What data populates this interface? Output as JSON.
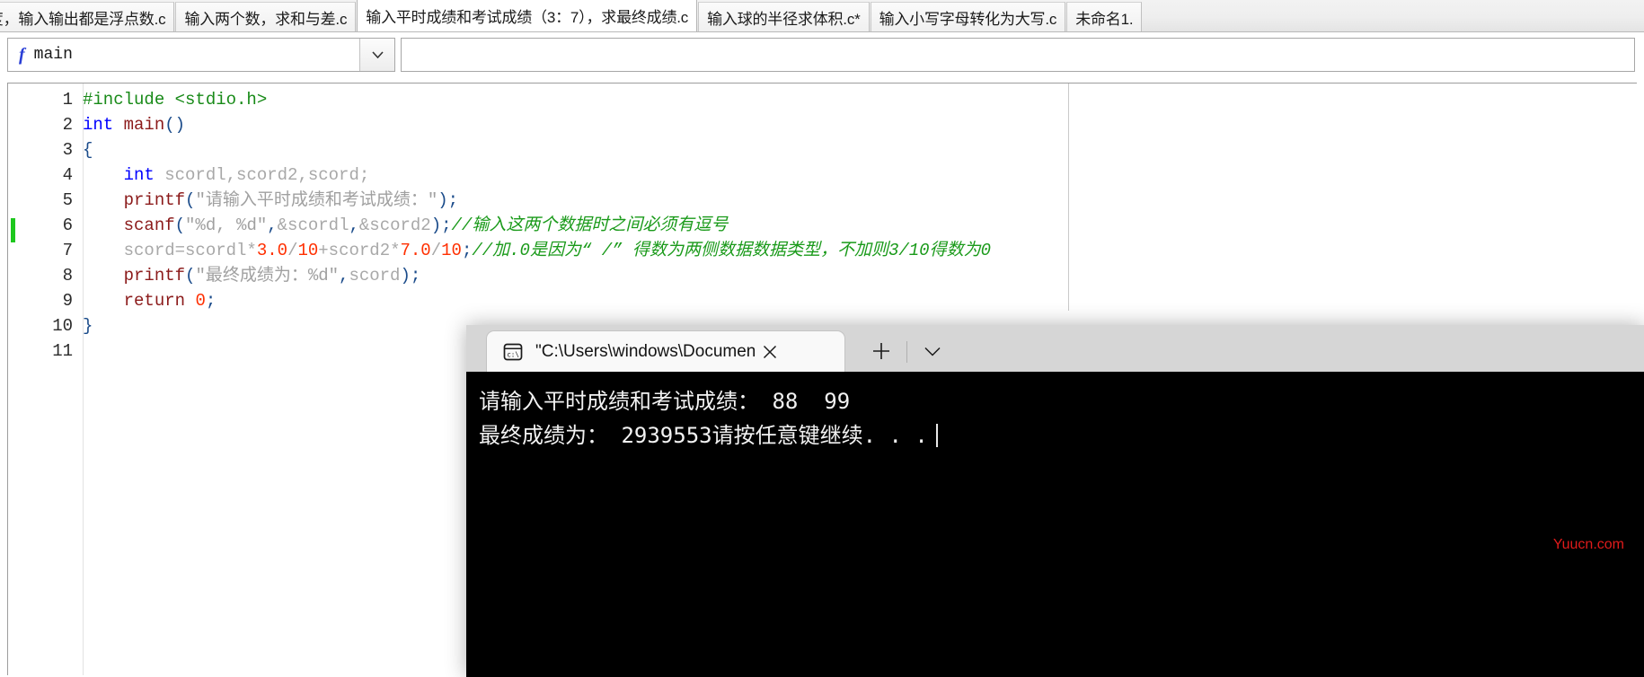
{
  "tabs": [
    {
      "label": "温度，输入输出都是浮点数.c",
      "active": false,
      "partial": true
    },
    {
      "label": "输入两个数，求和与差.c",
      "active": false
    },
    {
      "label": "输入平时成绩和考试成绩（3：7），求最终成绩.c",
      "active": true
    },
    {
      "label": "输入球的半径求体积.c*",
      "active": false
    },
    {
      "label": "输入小写字母转化为大写.c",
      "active": false
    },
    {
      "label": "未命名1.",
      "active": false,
      "partial": true
    }
  ],
  "func_selector": {
    "icon": "function-f-icon",
    "value": "main",
    "dropdown_icon": "chevron-down-icon"
  },
  "editor": {
    "change_marker_color": "#1ec81e",
    "lines": [
      {
        "num": "1",
        "tokens": [
          {
            "t": "#include <stdio.h>",
            "c": "c-pre"
          }
        ]
      },
      {
        "num": "2",
        "tokens": [
          {
            "t": "int",
            "c": "c-kw"
          },
          {
            "t": " ",
            "c": "c-plain"
          },
          {
            "t": "main",
            "c": "c-fn"
          },
          {
            "t": "()",
            "c": "c-brace"
          }
        ]
      },
      {
        "num": "3",
        "tokens": [
          {
            "t": "{",
            "c": "c-brace"
          }
        ]
      },
      {
        "num": "4",
        "tokens": [
          {
            "t": "    ",
            "c": "c-plain"
          },
          {
            "t": "int",
            "c": "c-kw"
          },
          {
            "t": " scordl,scord2,scord;",
            "c": "c-id"
          }
        ]
      },
      {
        "num": "5",
        "tokens": [
          {
            "t": "    ",
            "c": "c-plain"
          },
          {
            "t": "printf",
            "c": "c-fn"
          },
          {
            "t": "(",
            "c": "c-brace"
          },
          {
            "t": "\"请输入平时成绩和考试成绩：\"",
            "c": "c-str"
          },
          {
            "t": ")",
            "c": "c-brace"
          },
          {
            "t": ";",
            "c": "c-brace"
          }
        ]
      },
      {
        "num": "6",
        "tokens": [
          {
            "t": "    ",
            "c": "c-plain"
          },
          {
            "t": "scanf",
            "c": "c-fn"
          },
          {
            "t": "(",
            "c": "c-brace"
          },
          {
            "t": "\"%d, %d\"",
            "c": "c-str"
          },
          {
            "t": ",",
            "c": "c-brace"
          },
          {
            "t": "&scordl",
            "c": "c-id"
          },
          {
            "t": ",",
            "c": "c-brace"
          },
          {
            "t": "&scord2",
            "c": "c-id"
          },
          {
            "t": ")",
            "c": "c-brace"
          },
          {
            "t": ";",
            "c": "c-brace"
          },
          {
            "t": "//输入这两个数据时之间必须有逗号",
            "c": "c-cmt"
          }
        ]
      },
      {
        "num": "7",
        "tokens": [
          {
            "t": "    ",
            "c": "c-plain"
          },
          {
            "t": "scord=scordl*",
            "c": "c-id"
          },
          {
            "t": "3.0",
            "c": "c-num"
          },
          {
            "t": "/",
            "c": "c-id"
          },
          {
            "t": "10",
            "c": "c-num"
          },
          {
            "t": "+scord2*",
            "c": "c-id"
          },
          {
            "t": "7.0",
            "c": "c-num"
          },
          {
            "t": "/",
            "c": "c-id"
          },
          {
            "t": "10",
            "c": "c-num"
          },
          {
            "t": ";",
            "c": "c-brace"
          },
          {
            "t": "//加.0是因为“ /” 得数为两侧数据数据类型，不加则3/10得数为0",
            "c": "c-cmt"
          }
        ]
      },
      {
        "num": "8",
        "tokens": [
          {
            "t": "    ",
            "c": "c-plain"
          },
          {
            "t": "printf",
            "c": "c-fn"
          },
          {
            "t": "(",
            "c": "c-brace"
          },
          {
            "t": "\"最终成绩为：%d\"",
            "c": "c-str"
          },
          {
            "t": ",",
            "c": "c-brace"
          },
          {
            "t": "scord",
            "c": "c-id"
          },
          {
            "t": ")",
            "c": "c-brace"
          },
          {
            "t": ";",
            "c": "c-brace"
          }
        ]
      },
      {
        "num": "9",
        "tokens": [
          {
            "t": "    ",
            "c": "c-plain"
          },
          {
            "t": "return",
            "c": "c-fn"
          },
          {
            "t": " ",
            "c": "c-plain"
          },
          {
            "t": "0",
            "c": "c-num"
          },
          {
            "t": ";",
            "c": "c-brace"
          }
        ]
      },
      {
        "num": "10",
        "tokens": [
          {
            "t": "}",
            "c": "c-brace"
          }
        ]
      },
      {
        "num": "11",
        "tokens": []
      }
    ]
  },
  "terminal": {
    "tab": {
      "icon": "console-cmd-icon",
      "title": "\"C:\\Users\\windows\\Documen",
      "close_icon": "close-icon"
    },
    "new_tab_icon": "plus-icon",
    "dropdown_icon": "chevron-down-icon",
    "output_lines": [
      "请输入平时成绩和考试成绩： 88  99",
      "最终成绩为： 2939553请按任意键继续. . ."
    ],
    "background": "#000000",
    "foreground": "#f2f2f2"
  },
  "watermark": {
    "text": "Yuucn.com",
    "color": "#e01b1b"
  }
}
